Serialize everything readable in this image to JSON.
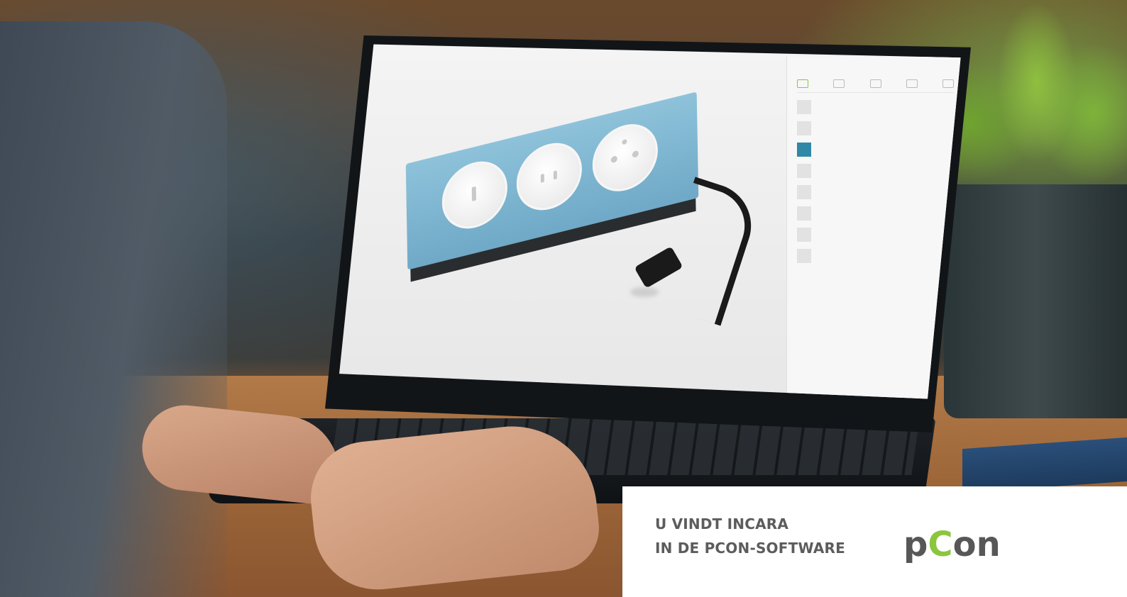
{
  "card": {
    "line1": "U VINDT INCARA",
    "line2": "IN DE PCON-SOFTWARE"
  },
  "logo": {
    "text": "pCon",
    "accent_color": "#8cc63f",
    "text_color": "#575757"
  },
  "colors": {
    "strip_blue": "#7fb7d3",
    "accent_green": "#8cc63f"
  }
}
